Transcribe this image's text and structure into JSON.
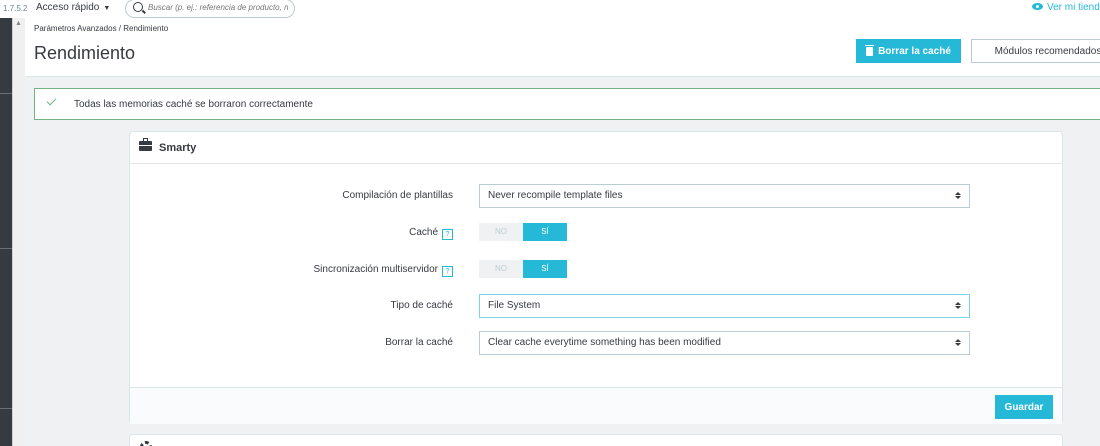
{
  "topbar": {
    "version": "1.7.5.2",
    "quick_access": "Acceso rápido",
    "search_placeholder": "Buscar (p. ej.: referencia de producto, no",
    "view_shop": "Ver mi tienda"
  },
  "header": {
    "breadcrumb": "Parámetros Avanzados  /  Rendimiento",
    "title": "Rendimiento",
    "clear_cache_button": "Borrar la caché",
    "recommended_modules_button": "Módulos recomendados"
  },
  "alert": {
    "message": "Todas las memorias caché se borraron correctamente"
  },
  "smarty_panel": {
    "title": "Smarty",
    "template_compilation": {
      "label": "Compilación de plantillas",
      "value": "Never recompile template files"
    },
    "cache": {
      "label": "Caché",
      "help": "?",
      "no": "NO",
      "yes": "SÍ",
      "selected": "yes"
    },
    "multi_server": {
      "label": "Sincronización multiservidor",
      "help": "?",
      "no": "NO",
      "yes": "SÍ",
      "selected": "yes"
    },
    "cache_type": {
      "label": "Tipo de caché",
      "value": "File System"
    },
    "clear_cache": {
      "label": "Borrar la caché",
      "value": "Clear cache everytime something has been modified"
    },
    "save_button": "Guardar"
  },
  "colors": {
    "accent": "#25b9d7",
    "success": "#70b580",
    "sidebar": "#363a41"
  },
  "icons": [
    "search-icon",
    "eye-icon",
    "trash-icon",
    "check-icon",
    "briefcase-icon",
    "help-icon",
    "select-arrows-icon",
    "gear-icon"
  ]
}
